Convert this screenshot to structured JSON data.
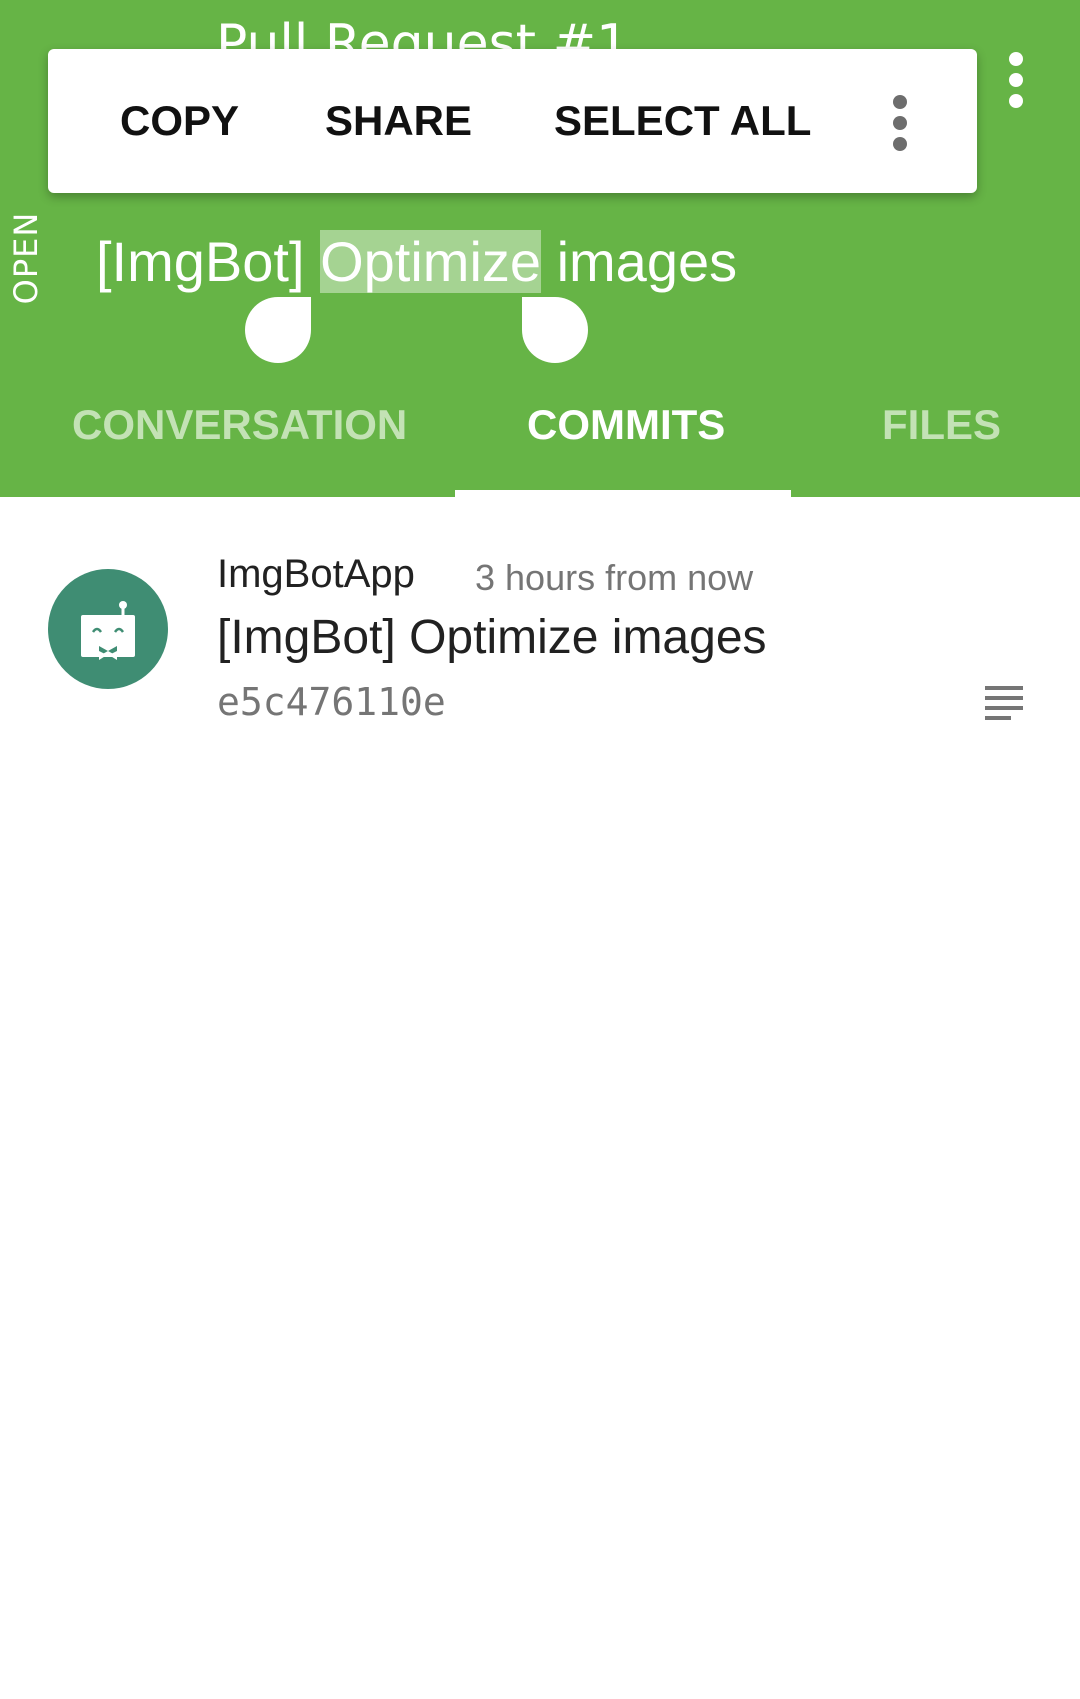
{
  "header": {
    "title": "Pull Request #1",
    "status": "OPEN",
    "pr_title_before": "[ImgBot] ",
    "pr_title_selected": "Optimize",
    "pr_title_after": " images"
  },
  "context_menu": {
    "copy": "COPY",
    "share": "SHARE",
    "select_all": "SELECT ALL"
  },
  "tabs": [
    {
      "label": "CONVERSATION",
      "active": false
    },
    {
      "label": "COMMITS",
      "active": true
    },
    {
      "label": "FILES",
      "active": false
    }
  ],
  "commits": [
    {
      "author": "ImgBotApp",
      "time": "3 hours from now",
      "message": "[ImgBot] Optimize images",
      "sha": "e5c476110e"
    }
  ],
  "colors": {
    "primary": "#66b446",
    "selection": "#a5d392",
    "avatar_bg": "#3f8d73",
    "inactive_tab": "#c3e2b5"
  },
  "icons": {
    "overflow": "more-vert-icon",
    "details": "notes-icon",
    "avatar": "robot-icon"
  }
}
